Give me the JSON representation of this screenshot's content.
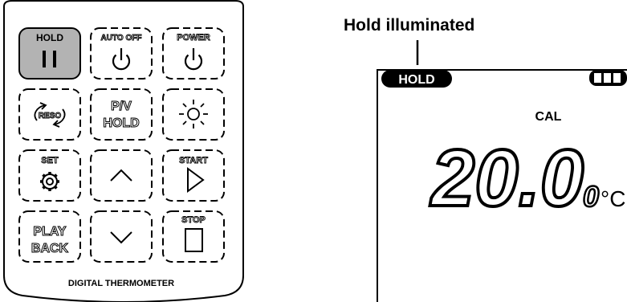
{
  "keypad": {
    "footer_label": "DIGITAL THERMOMETER",
    "buttons": [
      {
        "id": "hold",
        "top_label": "HOLD",
        "glyph": "pause"
      },
      {
        "id": "auto-off",
        "top_label": "AUTO OFF",
        "glyph": "power"
      },
      {
        "id": "power",
        "top_label": "POWER",
        "glyph": "power"
      },
      {
        "id": "reso",
        "top_label": "RESO",
        "glyph": "reso"
      },
      {
        "id": "pv-hold",
        "top_label": "P/V",
        "bottom_label": "HOLD",
        "glyph": "text"
      },
      {
        "id": "backlight",
        "top_label": "",
        "glyph": "sun"
      },
      {
        "id": "set",
        "top_label": "SET",
        "glyph": "gear"
      },
      {
        "id": "up",
        "top_label": "",
        "glyph": "chevron-up"
      },
      {
        "id": "start",
        "top_label": "START",
        "glyph": "play"
      },
      {
        "id": "playback",
        "top_label": "PLAY",
        "bottom_label": "BACK",
        "glyph": "text"
      },
      {
        "id": "down",
        "top_label": "",
        "glyph": "chevron-down"
      },
      {
        "id": "stop",
        "top_label": "STOP",
        "glyph": "square"
      }
    ]
  },
  "annotation": {
    "title": "Hold illuminated"
  },
  "lcd": {
    "hold_indicator": "HOLD",
    "mode_label": "CAL",
    "reading_main": "20.0",
    "reading_small": "0",
    "unit": "°C"
  }
}
